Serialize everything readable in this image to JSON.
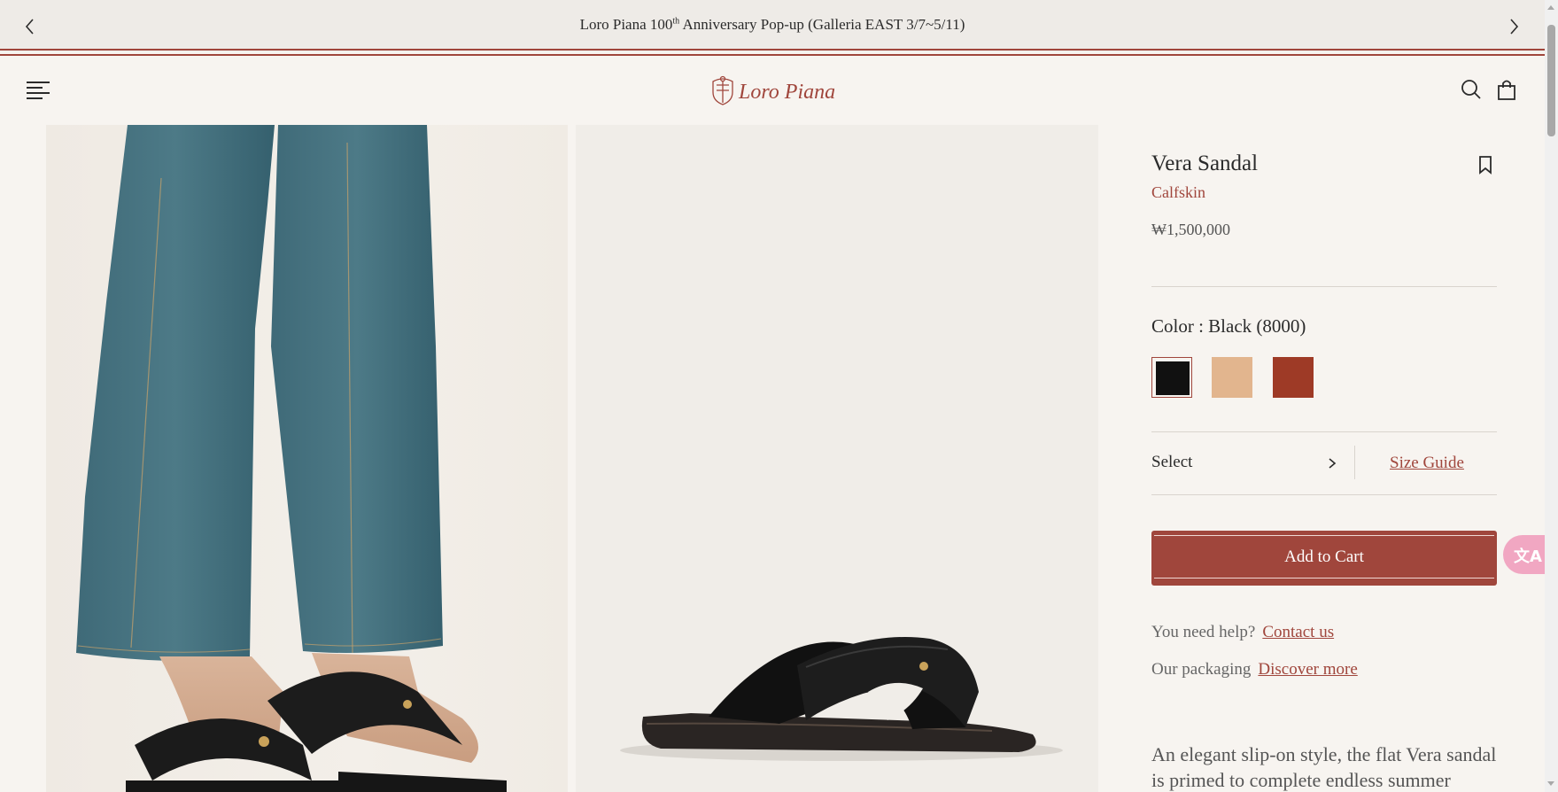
{
  "announcement": {
    "text_before": "Loro Piana 100",
    "superscript": "th",
    "text_after": " Anniversary Pop-up (Galleria EAST 3/7~5/11)"
  },
  "header": {
    "brand": "Loro Piana"
  },
  "product": {
    "name": "Vera Sandal",
    "material": "Calfskin",
    "price": "₩1,500,000",
    "color_label": "Color : Black (8000)",
    "swatches": [
      {
        "color": "#111111",
        "selected": true
      },
      {
        "color": "#e2b58e",
        "selected": false
      },
      {
        "color": "#9e3a26",
        "selected": false
      }
    ],
    "size_select": "Select",
    "size_guide": "Size Guide",
    "add_to_cart": "Add to Cart",
    "help_text": "You need help?",
    "help_link": "Contact us",
    "packaging_text": "Our packaging",
    "packaging_link": "Discover more",
    "description": "An elegant slip-on style, the flat Vera sandal is primed to complete endless summer"
  },
  "colors": {
    "accent": "#a0463c",
    "background": "#f7f4f0",
    "translate_button": "#f1a7c2"
  },
  "icons": {
    "prev": "chevron-left-icon",
    "next": "chevron-right-icon",
    "menu": "hamburger-menu-icon",
    "search": "search-icon",
    "bag": "shopping-bag-icon",
    "wishlist": "bookmark-icon",
    "translate": "translate-icon"
  }
}
